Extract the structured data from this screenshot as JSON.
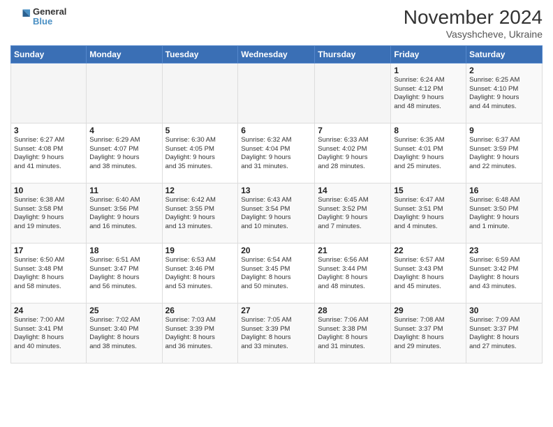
{
  "logo": {
    "line1": "General",
    "line2": "Blue"
  },
  "title": "November 2024",
  "subtitle": "Vasyshcheve, Ukraine",
  "headers": [
    "Sunday",
    "Monday",
    "Tuesday",
    "Wednesday",
    "Thursday",
    "Friday",
    "Saturday"
  ],
  "weeks": [
    [
      {
        "day": "",
        "info": ""
      },
      {
        "day": "",
        "info": ""
      },
      {
        "day": "",
        "info": ""
      },
      {
        "day": "",
        "info": ""
      },
      {
        "day": "",
        "info": ""
      },
      {
        "day": "1",
        "info": "Sunrise: 6:24 AM\nSunset: 4:12 PM\nDaylight: 9 hours\nand 48 minutes."
      },
      {
        "day": "2",
        "info": "Sunrise: 6:25 AM\nSunset: 4:10 PM\nDaylight: 9 hours\nand 44 minutes."
      }
    ],
    [
      {
        "day": "3",
        "info": "Sunrise: 6:27 AM\nSunset: 4:08 PM\nDaylight: 9 hours\nand 41 minutes."
      },
      {
        "day": "4",
        "info": "Sunrise: 6:29 AM\nSunset: 4:07 PM\nDaylight: 9 hours\nand 38 minutes."
      },
      {
        "day": "5",
        "info": "Sunrise: 6:30 AM\nSunset: 4:05 PM\nDaylight: 9 hours\nand 35 minutes."
      },
      {
        "day": "6",
        "info": "Sunrise: 6:32 AM\nSunset: 4:04 PM\nDaylight: 9 hours\nand 31 minutes."
      },
      {
        "day": "7",
        "info": "Sunrise: 6:33 AM\nSunset: 4:02 PM\nDaylight: 9 hours\nand 28 minutes."
      },
      {
        "day": "8",
        "info": "Sunrise: 6:35 AM\nSunset: 4:01 PM\nDaylight: 9 hours\nand 25 minutes."
      },
      {
        "day": "9",
        "info": "Sunrise: 6:37 AM\nSunset: 3:59 PM\nDaylight: 9 hours\nand 22 minutes."
      }
    ],
    [
      {
        "day": "10",
        "info": "Sunrise: 6:38 AM\nSunset: 3:58 PM\nDaylight: 9 hours\nand 19 minutes."
      },
      {
        "day": "11",
        "info": "Sunrise: 6:40 AM\nSunset: 3:56 PM\nDaylight: 9 hours\nand 16 minutes."
      },
      {
        "day": "12",
        "info": "Sunrise: 6:42 AM\nSunset: 3:55 PM\nDaylight: 9 hours\nand 13 minutes."
      },
      {
        "day": "13",
        "info": "Sunrise: 6:43 AM\nSunset: 3:54 PM\nDaylight: 9 hours\nand 10 minutes."
      },
      {
        "day": "14",
        "info": "Sunrise: 6:45 AM\nSunset: 3:52 PM\nDaylight: 9 hours\nand 7 minutes."
      },
      {
        "day": "15",
        "info": "Sunrise: 6:47 AM\nSunset: 3:51 PM\nDaylight: 9 hours\nand 4 minutes."
      },
      {
        "day": "16",
        "info": "Sunrise: 6:48 AM\nSunset: 3:50 PM\nDaylight: 9 hours\nand 1 minute."
      }
    ],
    [
      {
        "day": "17",
        "info": "Sunrise: 6:50 AM\nSunset: 3:48 PM\nDaylight: 8 hours\nand 58 minutes."
      },
      {
        "day": "18",
        "info": "Sunrise: 6:51 AM\nSunset: 3:47 PM\nDaylight: 8 hours\nand 56 minutes."
      },
      {
        "day": "19",
        "info": "Sunrise: 6:53 AM\nSunset: 3:46 PM\nDaylight: 8 hours\nand 53 minutes."
      },
      {
        "day": "20",
        "info": "Sunrise: 6:54 AM\nSunset: 3:45 PM\nDaylight: 8 hours\nand 50 minutes."
      },
      {
        "day": "21",
        "info": "Sunrise: 6:56 AM\nSunset: 3:44 PM\nDaylight: 8 hours\nand 48 minutes."
      },
      {
        "day": "22",
        "info": "Sunrise: 6:57 AM\nSunset: 3:43 PM\nDaylight: 8 hours\nand 45 minutes."
      },
      {
        "day": "23",
        "info": "Sunrise: 6:59 AM\nSunset: 3:42 PM\nDaylight: 8 hours\nand 43 minutes."
      }
    ],
    [
      {
        "day": "24",
        "info": "Sunrise: 7:00 AM\nSunset: 3:41 PM\nDaylight: 8 hours\nand 40 minutes."
      },
      {
        "day": "25",
        "info": "Sunrise: 7:02 AM\nSunset: 3:40 PM\nDaylight: 8 hours\nand 38 minutes."
      },
      {
        "day": "26",
        "info": "Sunrise: 7:03 AM\nSunset: 3:39 PM\nDaylight: 8 hours\nand 36 minutes."
      },
      {
        "day": "27",
        "info": "Sunrise: 7:05 AM\nSunset: 3:39 PM\nDaylight: 8 hours\nand 33 minutes."
      },
      {
        "day": "28",
        "info": "Sunrise: 7:06 AM\nSunset: 3:38 PM\nDaylight: 8 hours\nand 31 minutes."
      },
      {
        "day": "29",
        "info": "Sunrise: 7:08 AM\nSunset: 3:37 PM\nDaylight: 8 hours\nand 29 minutes."
      },
      {
        "day": "30",
        "info": "Sunrise: 7:09 AM\nSunset: 3:37 PM\nDaylight: 8 hours\nand 27 minutes."
      }
    ]
  ]
}
